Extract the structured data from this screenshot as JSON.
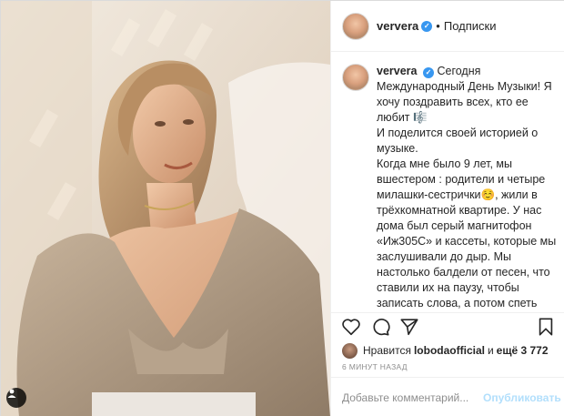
{
  "post": {
    "username": "ververa",
    "header": {
      "dot": "•",
      "follow_label": "Подписки"
    },
    "caption": {
      "username": "ververa",
      "lines": [
        "Сегодня Международный День Музыки! Я хочу поздравить всех, кто ее любит 🎼",
        "И поделится своей историей о музыке.",
        "Когда мне было 9 лет, мы вшестером : родители и четыре милашки-сестрички☺️, жили в трёхкомнатной квартире. У нас дома был серый магнитофон «Иж305С» и кассеты, которые мы заслушивали до дыр. Мы настолько балдели от песен, что ставили их на паузу, чтобы записать слова, а потом спеть самим. Моё страстное увлечение музыкой началось именно тогда, с хитов Erasure , Ace of Base, Филиппа Киркорова, Вадима Казаченко, Ирины Аллегровой и Юрия Лозы -"
      ]
    },
    "likes": {
      "prefix": "Нравится",
      "user": "lobodaofficial",
      "middle": "и",
      "count": "ещё 3 772"
    },
    "time": "6 минут назад",
    "comment": {
      "placeholder": "Добавьте комментарий...",
      "post_label": "Опубликовать"
    },
    "colors": {
      "verified": "#3897f0",
      "post_disabled": "#b2dffc",
      "secondary_text": "#8e8e8e"
    },
    "icons": [
      "verified-icon",
      "heart-icon",
      "comment-icon",
      "share-icon",
      "bookmark-icon",
      "tag-people-icon"
    ]
  }
}
